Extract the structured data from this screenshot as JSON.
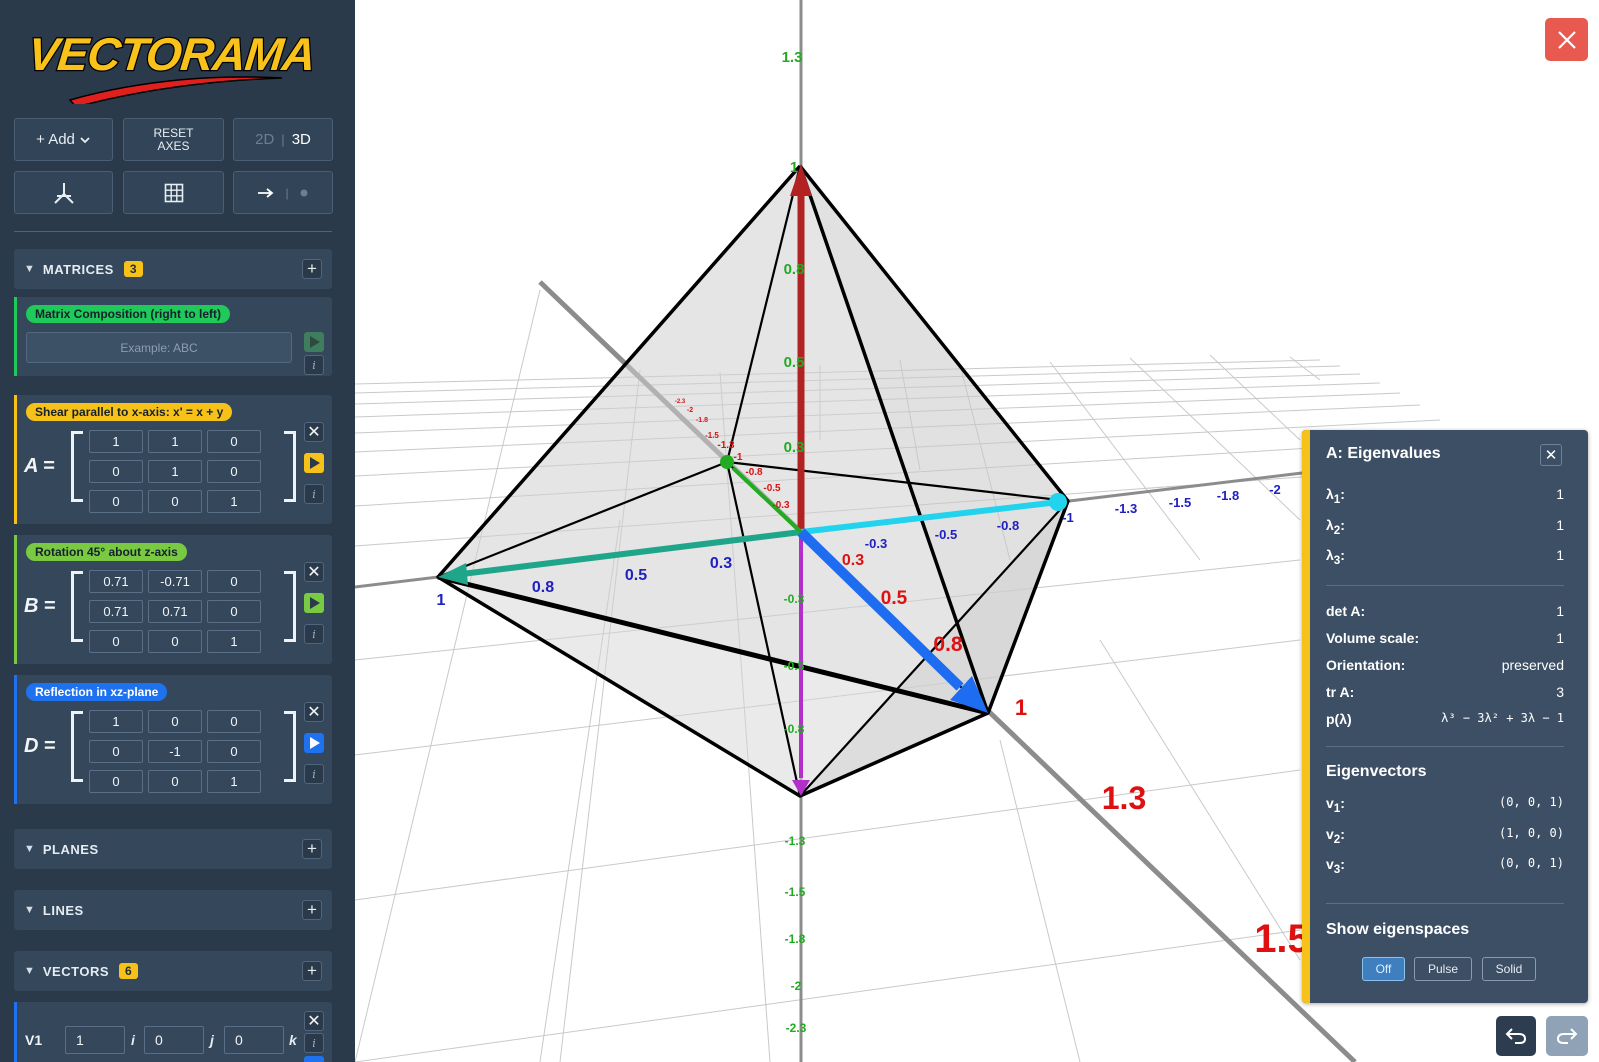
{
  "app": {
    "logo_text": "VECTORAMA"
  },
  "toolbar": {
    "add_label": "+ Add",
    "reset_line1": "RESET",
    "reset_line2": "AXES",
    "mode_2d": "2D",
    "mode_sep": "|",
    "mode_3d": "3D",
    "arrow_sep": "|"
  },
  "sections": {
    "matrices": {
      "title": "MATRICES",
      "count": "3"
    },
    "planes": {
      "title": "PLANES"
    },
    "lines": {
      "title": "LINES"
    },
    "vectors": {
      "title": "VECTORS",
      "count": "6"
    }
  },
  "composition": {
    "tag": "Matrix Composition (right to left)",
    "placeholder": "Example: ABC",
    "color": "#1fc95a"
  },
  "matrices": [
    {
      "name": "A",
      "eq": "=",
      "color": "#f6c21a",
      "tag": "Shear parallel to x-axis: x' = x + y",
      "rows": [
        [
          "1",
          "1",
          "0"
        ],
        [
          "0",
          "1",
          "0"
        ],
        [
          "0",
          "0",
          "1"
        ]
      ]
    },
    {
      "name": "B",
      "eq": "=",
      "color": "#7ac943",
      "tag": "Rotation 45° about z-axis",
      "rows": [
        [
          "0.71",
          "-0.71",
          "0"
        ],
        [
          "0.71",
          "0.71",
          "0"
        ],
        [
          "0",
          "0",
          "1"
        ]
      ]
    },
    {
      "name": "D",
      "eq": "=",
      "color": "#1e72f0",
      "tag": "Reflection in xz-plane",
      "rows": [
        [
          "1",
          "0",
          "0"
        ],
        [
          "0",
          "-1",
          "0"
        ],
        [
          "0",
          "0",
          "1"
        ]
      ]
    }
  ],
  "vector_row": {
    "name": "V1",
    "values": [
      "1",
      "0",
      "0"
    ],
    "units": [
      "i",
      "j",
      "k"
    ]
  },
  "eigen_panel": {
    "title": "A: Eigenvalues",
    "lambdas": [
      {
        "label": "λ",
        "sub": "1",
        "value": "1"
      },
      {
        "label": "λ",
        "sub": "2",
        "value": "1"
      },
      {
        "label": "λ",
        "sub": "3",
        "value": "1"
      }
    ],
    "stats": [
      {
        "label": "det A:",
        "value": "1"
      },
      {
        "label": "Volume scale:",
        "value": "1"
      },
      {
        "label": "Orientation:",
        "value": "preserved"
      },
      {
        "label": "tr A:",
        "value": "3"
      },
      {
        "label": "p(λ)",
        "value": "λ³ − 3λ² + 3λ − 1"
      }
    ],
    "eigenvectors_title": "Eigenvectors",
    "eigenvectors": [
      {
        "label": "v",
        "sub": "1",
        "value": "(0, 0, 1)"
      },
      {
        "label": "v",
        "sub": "2",
        "value": "(1, 0, 0)"
      },
      {
        "label": "v",
        "sub": "3",
        "value": "(0, 0, 1)"
      }
    ],
    "eigenspaces_title": "Show eigenspaces",
    "eigenspace_options": [
      "Off",
      "Pulse",
      "Solid"
    ],
    "eigenspace_selected": "Off"
  },
  "scene": {
    "axis_labels": {
      "y_pos": [
        "1.3",
        "1",
        "0.8",
        "0.5",
        "0.3",
        "-0.3",
        "-0.5",
        "-0.8",
        "-1.3",
        "-1.5",
        "-1.8",
        "-2",
        "-2.3"
      ],
      "x_left": [
        "1",
        "0.8",
        "0.5",
        "0.3"
      ],
      "x_right": [
        "-0.3",
        "-0.5",
        "-0.8",
        "-1",
        "-1.3",
        "-1.5",
        "-1.8",
        "-2"
      ],
      "z_near": [
        "0.3",
        "0.5",
        "0.8",
        "1",
        "1.3",
        "1.5"
      ],
      "z_far": [
        "-0.3",
        "-0.5",
        "-0.8",
        "-1",
        "-1.3",
        "-1.5",
        "-1.8",
        "-2",
        "-2.3"
      ]
    },
    "colors": {
      "x_labels": "#2020c0",
      "y_labels": "#22aa22",
      "z_labels": "#dd1111",
      "vec_red": "#b22222",
      "vec_teal": "#1fa68a",
      "vec_cyan": "#22d3ee",
      "vec_blue": "#1e6cf0",
      "vec_green": "#22aa22",
      "vec_purple": "#b22fc9"
    }
  }
}
